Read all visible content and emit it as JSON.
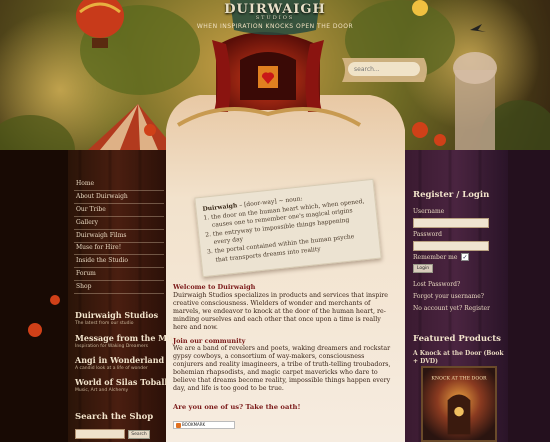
{
  "header": {
    "site_name": "DUIRWAIGH",
    "site_sub": "STUDIOS",
    "tagline": "WHEN INSPIRATION KNOCKS OPEN THE DOOR",
    "search_placeholder": "search..."
  },
  "nav": {
    "items": [
      "Home",
      "About Duirwaigh",
      "Our Tribe",
      "Gallery",
      "Duirwaigh Films",
      "Muse for Hire!",
      "Inside the Studio",
      "Forum",
      "Shop"
    ]
  },
  "sidebar_blogs": [
    {
      "title": "Duirwaigh Studios",
      "sub": "The latest from our studio"
    },
    {
      "title": "Message from the Muse",
      "sub": "Inspiration for Waking Dreamers"
    },
    {
      "title": "Angi in Wonderland",
      "sub": "A candid look at a life of wonder"
    },
    {
      "title": "World of Silas Toball",
      "sub": "Music, Art and Alchemy"
    }
  ],
  "shop_search": {
    "title": "Search the Shop",
    "button": "Search"
  },
  "definition": {
    "word": "Duirwaigh",
    "pron": " – [door-way] ~ noun:",
    "lines": [
      "1. the door on the human heart which, when opened,",
      "    causes one to remember one's magical origins",
      "2. the entryway to impossible things happening",
      "    every day",
      "3. the portal contained within the human psyche",
      "    that transports dreams into reality"
    ]
  },
  "main": {
    "welcome_heading": "Welcome to Duirwaigh",
    "welcome_text": "Duirwaigh Studios specializes in products and services that inspire creative consciousness. Wielders of wonder and merchants of marvels, we endeavor to knock at the door of the human heart, re-minding ourselves and each other that once upon a time is really here and now.",
    "community_heading": "Join our community",
    "community_text": "We are a band of revelers and poets, waking dreamers and rockstar gypsy cowboys, a consortium of way-makers, consciousness conjurers and reality imagineers, a tribe of truth-telling troubadors, bohemian rhapsodists, and magic carpet mavericks who dare to believe that dreams become reality, impossible things happen every day, and life is too good to be true.",
    "oath_text": "Are you one of us?",
    "oath_link": "Take the oath!",
    "bookmark": "BOOKMARK"
  },
  "login": {
    "title": "Register / Login",
    "username_label": "Username",
    "password_label": "Password",
    "remember_label": "Remember me",
    "remember_checked": true,
    "login_button": "Login",
    "lost_password": "Lost Password?",
    "forgot_username": "Forgot your username?",
    "no_account": "No account yet?",
    "register": "Register"
  },
  "featured": {
    "title": "Featured Products",
    "product": "A Knock at the Door (Book + DVD)",
    "cover_title": "KNOCK AT THE DOOR"
  }
}
